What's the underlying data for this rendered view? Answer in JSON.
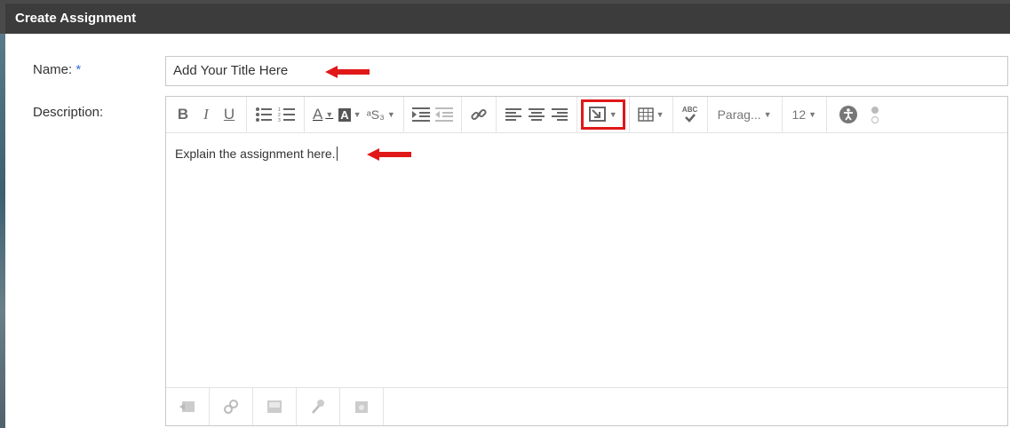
{
  "dialog": {
    "title": "Create Assignment"
  },
  "form": {
    "name_label": "Name:",
    "required_mark": "*",
    "name_value": "Add Your Title Here",
    "description_label": "Description:",
    "description_text": "Explain the assignment here."
  },
  "toolbar": {
    "paragraph_label": "Parag...",
    "font_size": "12",
    "abc_label": "ABC",
    "bold": "B",
    "italic": "I",
    "underline": "U",
    "font_color": "A",
    "highlight": "A",
    "sup_sub": "ᵃS₃"
  },
  "colors": {
    "titlebar": "#3c3c3c",
    "highlight_border": "#e01818",
    "arrow": "#e01818",
    "required": "#3b6fd6"
  },
  "icons": {
    "insert": "insert-content-icon",
    "table": "table-icon",
    "spellcheck": "spellcheck-icon",
    "accessibility": "accessibility-icon"
  }
}
